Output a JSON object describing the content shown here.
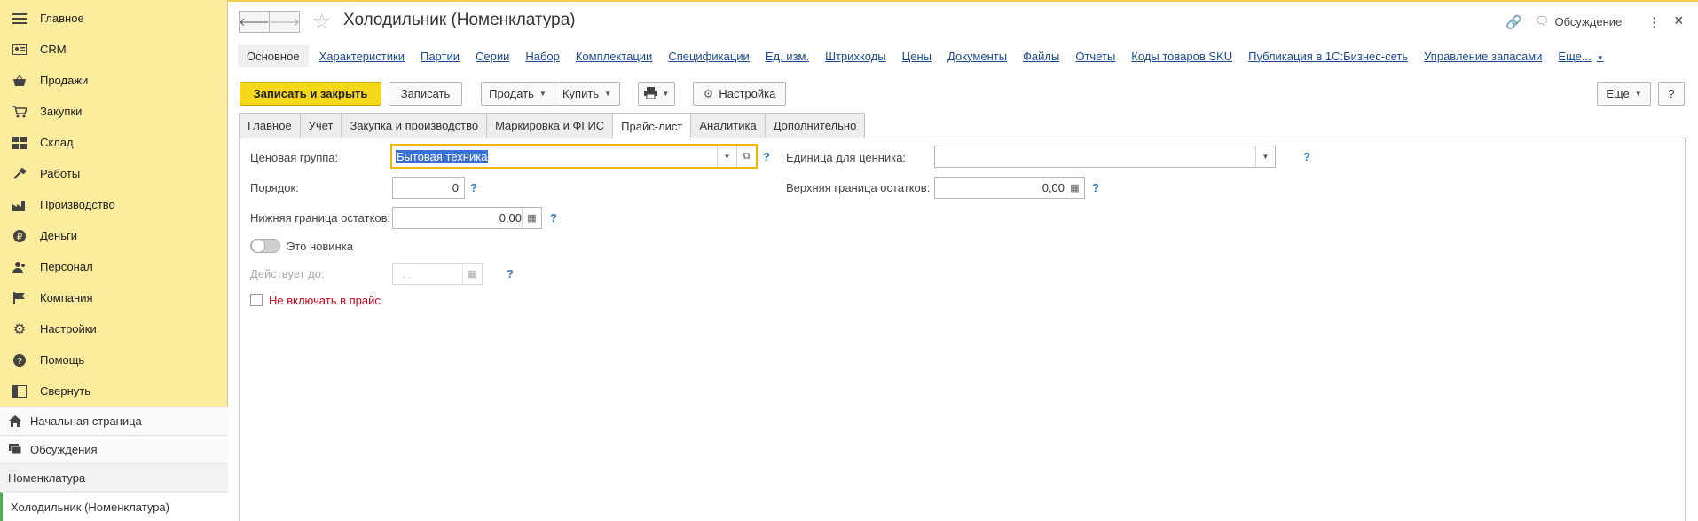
{
  "sidebar": {
    "items": [
      {
        "label": "Главное",
        "icon": "menu-icon"
      },
      {
        "label": "CRM",
        "icon": "crm-icon"
      },
      {
        "label": "Продажи",
        "icon": "basket-icon"
      },
      {
        "label": "Закупки",
        "icon": "cart-icon"
      },
      {
        "label": "Склад",
        "icon": "warehouse-icon"
      },
      {
        "label": "Работы",
        "icon": "tools-icon"
      },
      {
        "label": "Производство",
        "icon": "factory-icon"
      },
      {
        "label": "Деньги",
        "icon": "money-icon"
      },
      {
        "label": "Персонал",
        "icon": "people-icon"
      },
      {
        "label": "Компания",
        "icon": "flag-icon"
      },
      {
        "label": "Настройки",
        "icon": "gear-icon"
      },
      {
        "label": "Помощь",
        "icon": "help-icon"
      },
      {
        "label": "Свернуть",
        "icon": "collapse-icon"
      }
    ],
    "home": "Начальная страница",
    "discussions": "Обсуждения",
    "section": "Номенклатура",
    "open_item": "Холодильник (Номенклатура)"
  },
  "header": {
    "title": "Холодильник (Номенклатура)",
    "discuss": "Обсуждение",
    "more": "⋮",
    "close": "×"
  },
  "links": [
    "Основное",
    "Характеристики",
    "Партии",
    "Серии",
    "Набор",
    "Комплектации",
    "Спецификации",
    "Ед. изм.",
    "Штрихкоды",
    "Цены",
    "Документы",
    "Файлы",
    "Отчеты",
    "Коды товаров SKU",
    "Публикация в 1С:Бизнес-сеть",
    "Управление запасами",
    "Еще..."
  ],
  "toolbar": {
    "save_close": "Записать и закрыть",
    "save": "Записать",
    "sell": "Продать",
    "buy": "Купить",
    "settings": "Настройка",
    "more": "Еще",
    "help": "?"
  },
  "tabs": [
    "Главное",
    "Учет",
    "Закупка и производство",
    "Маркировка и ФГИС",
    "Прайс-лист",
    "Аналитика",
    "Дополнительно"
  ],
  "form": {
    "price_group_label": "Ценовая группа:",
    "price_group_value": "Бытовая техника",
    "order_label": "Порядок:",
    "order_value": "0",
    "min_stock_label": "Нижняя граница остатков:",
    "min_stock_value": "0,00",
    "new_label": "Это новинка",
    "valid_until_label": "Действует до:",
    "valid_until_value": " .  .",
    "exclude_label": "Не включать в прайс",
    "unit_label": "Единица для ценника:",
    "unit_value": "",
    "max_stock_label": "Верхняя граница остатков:",
    "max_stock_value": "0,00",
    "q": "?"
  },
  "colors": {
    "sidebar": "#fbec9e",
    "primary": "#f6d81a",
    "link": "#1d4a8f",
    "focus": "#f1b800",
    "warning": "#d0021b"
  }
}
